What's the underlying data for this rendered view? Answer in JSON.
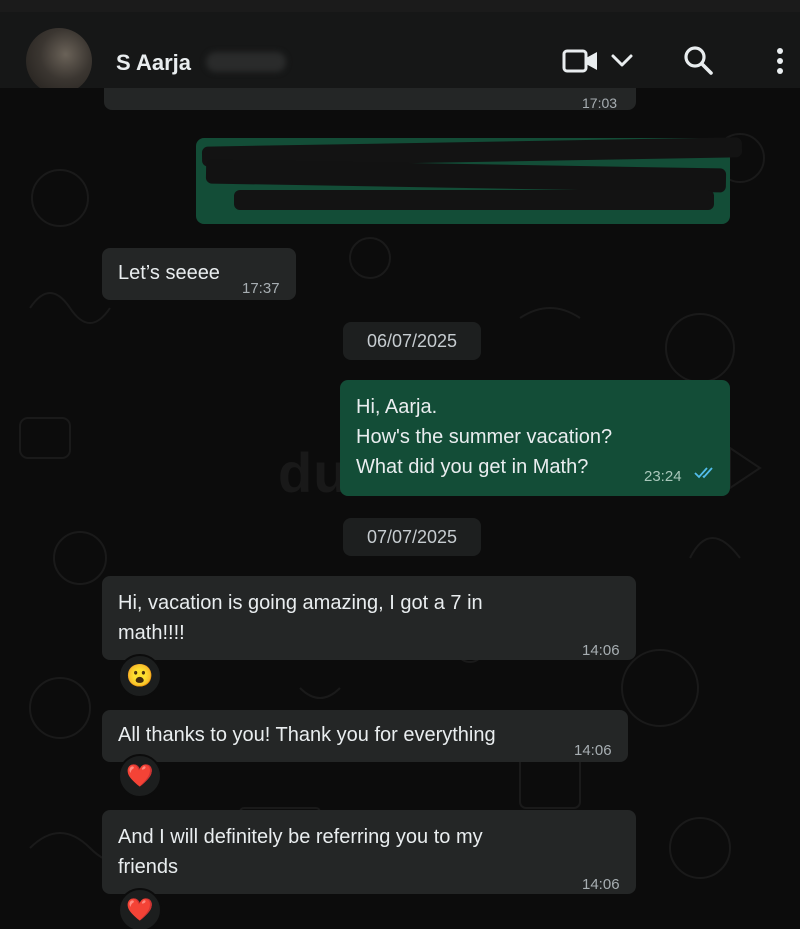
{
  "header": {
    "contact_name": "S Aarja",
    "icons": [
      "video-call-icon",
      "chevron-down-icon",
      "search-icon",
      "more-menu-icon"
    ]
  },
  "messages": [
    {
      "id": "m0",
      "direction": "in",
      "time": "17:03",
      "text": ""
    },
    {
      "id": "m1",
      "direction": "out",
      "time": "",
      "text": ""
    },
    {
      "id": "m2",
      "direction": "in",
      "text": "Let’s seeee",
      "time": "17:37"
    },
    {
      "id": "m3",
      "direction": "out",
      "text_lines": [
        "Hi, Aarja.",
        "How's the summer vacation?",
        "What did you get in Math?"
      ],
      "time": "23:24",
      "status": "read"
    },
    {
      "id": "m4",
      "direction": "in",
      "text_lines": [
        "Hi, vacation is going amazing, I got a 7 in",
        "math!!!!"
      ],
      "time": "14:06",
      "reaction": "😮"
    },
    {
      "id": "m5",
      "direction": "in",
      "text": "All thanks to you! Thank you for everything",
      "time": "14:06",
      "reaction": "❤️"
    },
    {
      "id": "m6",
      "direction": "in",
      "text_lines": [
        "And I will definitely be referring you to my",
        "friends"
      ],
      "time": "14:06",
      "reaction": "❤️"
    }
  ],
  "date_dividers": [
    "06/07/2025",
    "07/07/2025"
  ],
  "watermark": "dubizzle",
  "colors": {
    "incoming_bubble": "#242626",
    "outgoing_bubble": "#134d37",
    "read_ticks": "#53bdeb"
  }
}
